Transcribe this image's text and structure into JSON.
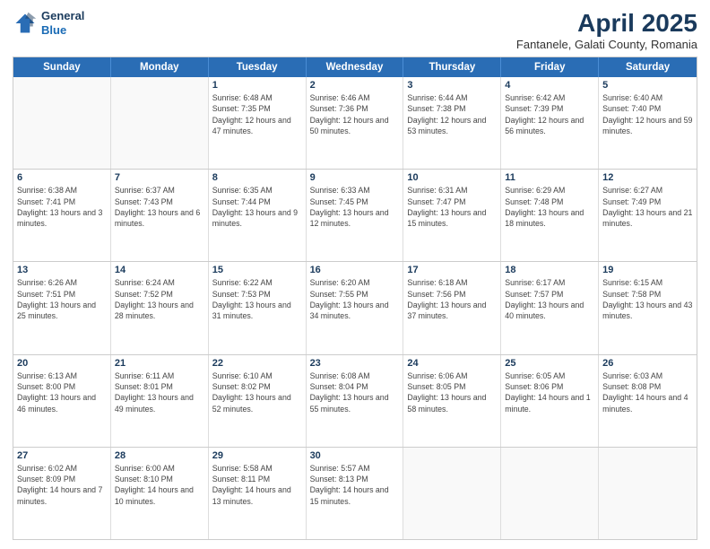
{
  "header": {
    "logo_general": "General",
    "logo_blue": "Blue",
    "month_year": "April 2025",
    "location": "Fantanele, Galati County, Romania"
  },
  "calendar": {
    "days_of_week": [
      "Sunday",
      "Monday",
      "Tuesday",
      "Wednesday",
      "Thursday",
      "Friday",
      "Saturday"
    ],
    "rows": [
      [
        {
          "day": "",
          "info": ""
        },
        {
          "day": "",
          "info": ""
        },
        {
          "day": "1",
          "info": "Sunrise: 6:48 AM\nSunset: 7:35 PM\nDaylight: 12 hours and 47 minutes."
        },
        {
          "day": "2",
          "info": "Sunrise: 6:46 AM\nSunset: 7:36 PM\nDaylight: 12 hours and 50 minutes."
        },
        {
          "day": "3",
          "info": "Sunrise: 6:44 AM\nSunset: 7:38 PM\nDaylight: 12 hours and 53 minutes."
        },
        {
          "day": "4",
          "info": "Sunrise: 6:42 AM\nSunset: 7:39 PM\nDaylight: 12 hours and 56 minutes."
        },
        {
          "day": "5",
          "info": "Sunrise: 6:40 AM\nSunset: 7:40 PM\nDaylight: 12 hours and 59 minutes."
        }
      ],
      [
        {
          "day": "6",
          "info": "Sunrise: 6:38 AM\nSunset: 7:41 PM\nDaylight: 13 hours and 3 minutes."
        },
        {
          "day": "7",
          "info": "Sunrise: 6:37 AM\nSunset: 7:43 PM\nDaylight: 13 hours and 6 minutes."
        },
        {
          "day": "8",
          "info": "Sunrise: 6:35 AM\nSunset: 7:44 PM\nDaylight: 13 hours and 9 minutes."
        },
        {
          "day": "9",
          "info": "Sunrise: 6:33 AM\nSunset: 7:45 PM\nDaylight: 13 hours and 12 minutes."
        },
        {
          "day": "10",
          "info": "Sunrise: 6:31 AM\nSunset: 7:47 PM\nDaylight: 13 hours and 15 minutes."
        },
        {
          "day": "11",
          "info": "Sunrise: 6:29 AM\nSunset: 7:48 PM\nDaylight: 13 hours and 18 minutes."
        },
        {
          "day": "12",
          "info": "Sunrise: 6:27 AM\nSunset: 7:49 PM\nDaylight: 13 hours and 21 minutes."
        }
      ],
      [
        {
          "day": "13",
          "info": "Sunrise: 6:26 AM\nSunset: 7:51 PM\nDaylight: 13 hours and 25 minutes."
        },
        {
          "day": "14",
          "info": "Sunrise: 6:24 AM\nSunset: 7:52 PM\nDaylight: 13 hours and 28 minutes."
        },
        {
          "day": "15",
          "info": "Sunrise: 6:22 AM\nSunset: 7:53 PM\nDaylight: 13 hours and 31 minutes."
        },
        {
          "day": "16",
          "info": "Sunrise: 6:20 AM\nSunset: 7:55 PM\nDaylight: 13 hours and 34 minutes."
        },
        {
          "day": "17",
          "info": "Sunrise: 6:18 AM\nSunset: 7:56 PM\nDaylight: 13 hours and 37 minutes."
        },
        {
          "day": "18",
          "info": "Sunrise: 6:17 AM\nSunset: 7:57 PM\nDaylight: 13 hours and 40 minutes."
        },
        {
          "day": "19",
          "info": "Sunrise: 6:15 AM\nSunset: 7:58 PM\nDaylight: 13 hours and 43 minutes."
        }
      ],
      [
        {
          "day": "20",
          "info": "Sunrise: 6:13 AM\nSunset: 8:00 PM\nDaylight: 13 hours and 46 minutes."
        },
        {
          "day": "21",
          "info": "Sunrise: 6:11 AM\nSunset: 8:01 PM\nDaylight: 13 hours and 49 minutes."
        },
        {
          "day": "22",
          "info": "Sunrise: 6:10 AM\nSunset: 8:02 PM\nDaylight: 13 hours and 52 minutes."
        },
        {
          "day": "23",
          "info": "Sunrise: 6:08 AM\nSunset: 8:04 PM\nDaylight: 13 hours and 55 minutes."
        },
        {
          "day": "24",
          "info": "Sunrise: 6:06 AM\nSunset: 8:05 PM\nDaylight: 13 hours and 58 minutes."
        },
        {
          "day": "25",
          "info": "Sunrise: 6:05 AM\nSunset: 8:06 PM\nDaylight: 14 hours and 1 minute."
        },
        {
          "day": "26",
          "info": "Sunrise: 6:03 AM\nSunset: 8:08 PM\nDaylight: 14 hours and 4 minutes."
        }
      ],
      [
        {
          "day": "27",
          "info": "Sunrise: 6:02 AM\nSunset: 8:09 PM\nDaylight: 14 hours and 7 minutes."
        },
        {
          "day": "28",
          "info": "Sunrise: 6:00 AM\nSunset: 8:10 PM\nDaylight: 14 hours and 10 minutes."
        },
        {
          "day": "29",
          "info": "Sunrise: 5:58 AM\nSunset: 8:11 PM\nDaylight: 14 hours and 13 minutes."
        },
        {
          "day": "30",
          "info": "Sunrise: 5:57 AM\nSunset: 8:13 PM\nDaylight: 14 hours and 15 minutes."
        },
        {
          "day": "",
          "info": ""
        },
        {
          "day": "",
          "info": ""
        },
        {
          "day": "",
          "info": ""
        }
      ]
    ]
  }
}
